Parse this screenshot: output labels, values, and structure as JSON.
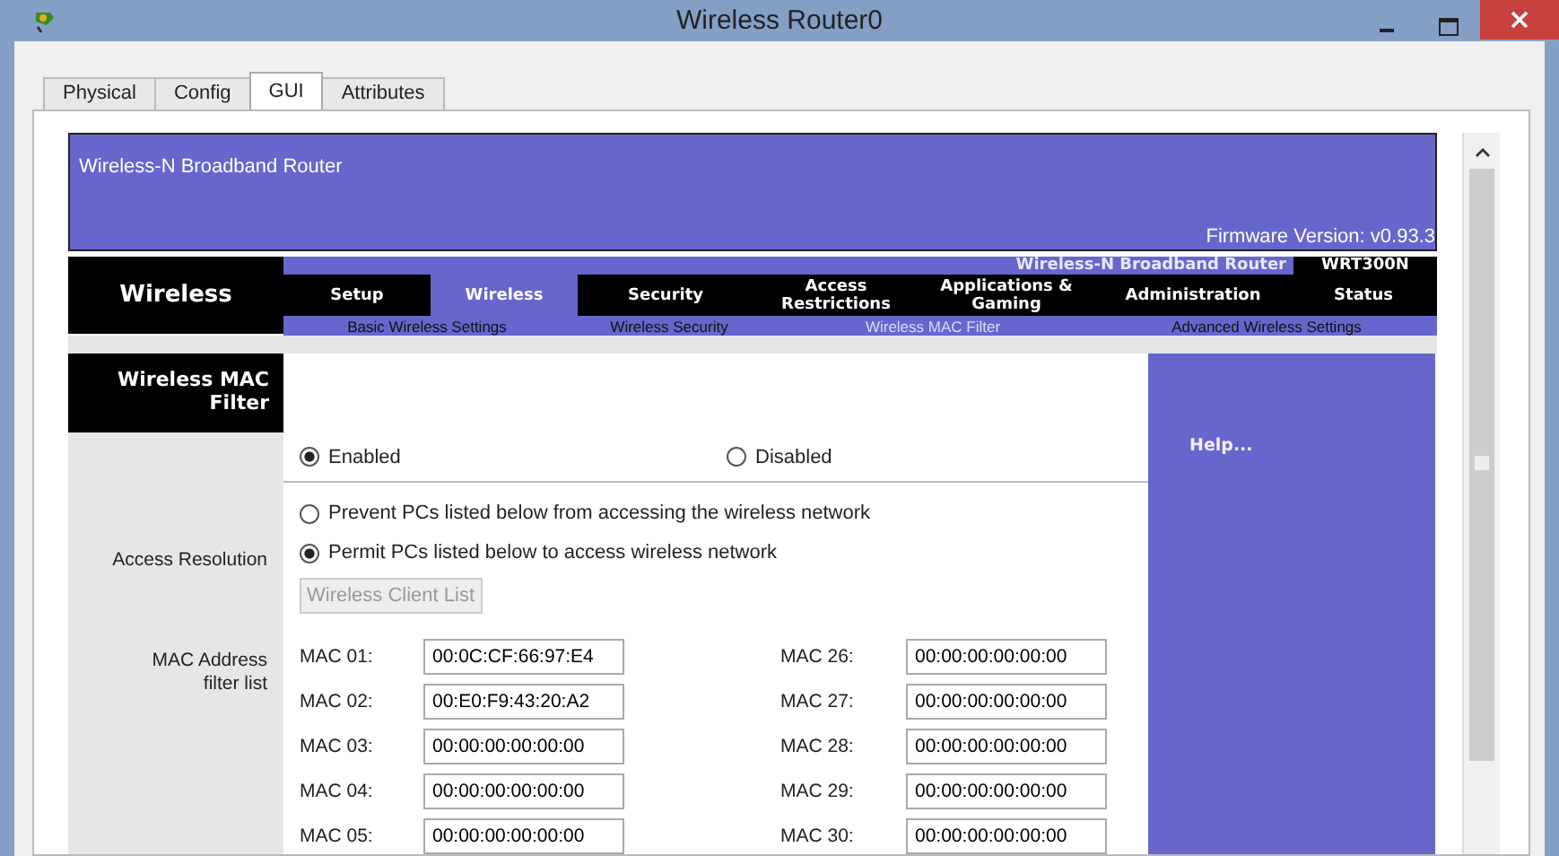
{
  "window": {
    "title": "Wireless Router0"
  },
  "tabs": [
    {
      "label": "Physical",
      "selected": false
    },
    {
      "label": "Config",
      "selected": false
    },
    {
      "label": "GUI",
      "selected": true
    },
    {
      "label": "Attributes",
      "selected": false
    }
  ],
  "router": {
    "header": {
      "title": "Wireless-N Broadband Router",
      "firmware": "Firmware Version: v0.93.3"
    },
    "nav": {
      "section_title": "Wireless",
      "product_name": "Wireless-N Broadband Router",
      "model": "WRT300N",
      "menu": [
        {
          "label": "Setup",
          "selected": false
        },
        {
          "label": "Wireless",
          "selected": true
        },
        {
          "label": "Security",
          "selected": false
        },
        {
          "label": "Access Restrictions",
          "selected": false
        },
        {
          "label": "Applications & Gaming",
          "selected": false
        },
        {
          "label": "Administration",
          "selected": false
        },
        {
          "label": "Status",
          "selected": false
        }
      ],
      "submenu": [
        {
          "label": "Basic Wireless Settings",
          "selected": false
        },
        {
          "label": "Wireless Security",
          "selected": false
        },
        {
          "label": "Wireless MAC Filter",
          "selected": true
        },
        {
          "label": "Advanced Wireless Settings",
          "selected": false
        }
      ]
    },
    "page": {
      "section_title": "Wireless MAC Filter",
      "filter_options": [
        {
          "label": "Enabled",
          "selected": true
        },
        {
          "label": "Disabled",
          "selected": false
        }
      ],
      "access_resolution": {
        "label": "Access Resolution",
        "options": [
          {
            "label": "Prevent PCs listed below from accessing the wireless network",
            "selected": false
          },
          {
            "label": "Permit PCs listed below to access wireless network",
            "selected": true
          }
        ]
      },
      "client_list_button": {
        "label": "Wireless Client List",
        "disabled": true
      },
      "mac_filter": {
        "label": "MAC Address filter list",
        "entries": [
          {
            "label": "MAC 01:",
            "value": "00:0C:CF:66:97:E4"
          },
          {
            "label": "MAC 26:",
            "value": "00:00:00:00:00:00"
          },
          {
            "label": "MAC 02:",
            "value": "00:E0:F9:43:20:A2"
          },
          {
            "label": "MAC 27:",
            "value": "00:00:00:00:00:00"
          },
          {
            "label": "MAC 03:",
            "value": "00:00:00:00:00:00"
          },
          {
            "label": "MAC 28:",
            "value": "00:00:00:00:00:00"
          },
          {
            "label": "MAC 04:",
            "value": "00:00:00:00:00:00"
          },
          {
            "label": "MAC 29:",
            "value": "00:00:00:00:00:00"
          },
          {
            "label": "MAC 05:",
            "value": "00:00:00:00:00:00"
          },
          {
            "label": "MAC 30:",
            "value": "00:00:00:00:00:00"
          }
        ]
      }
    },
    "help": {
      "title": "Help..."
    }
  }
}
